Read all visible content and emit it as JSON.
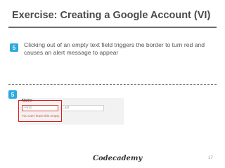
{
  "slide": {
    "title": "Exercise: Creating a Google Account (VI)",
    "page_number": "17",
    "logo_text": "Codecademy"
  },
  "step": {
    "number": "5",
    "badge_color": "#2aa9e0",
    "instruction": "Clicking out of an empty text field triggers the border to turn red and causes an alert message to appear"
  },
  "form": {
    "name_label": "Name",
    "first_placeholder": "First",
    "last_placeholder": "Last",
    "error_message": "You can't leave this empty.",
    "error_color": "#dd4b39",
    "highlight_color": "#e01818"
  }
}
